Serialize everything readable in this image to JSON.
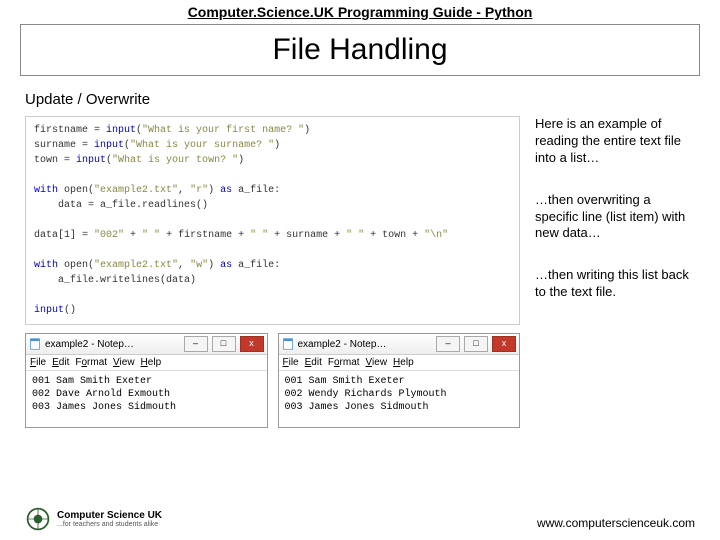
{
  "header": "Computer.Science.UK Programming Guide - Python",
  "title": "File Handling",
  "section": "Update / Overwrite",
  "code": {
    "l1a": "firstname = ",
    "l1b": "input",
    "l1c": "(",
    "l1d": "\"What is your first name? \"",
    "l1e": ")",
    "l2a": "surname = ",
    "l2b": "input",
    "l2c": "(",
    "l2d": "\"What is your surname? \"",
    "l2e": ")",
    "l3a": "town = ",
    "l3b": "input",
    "l3c": "(",
    "l3d": "\"What is your town? \"",
    "l3e": ")",
    "l4a": "with",
    "l4b": " open(",
    "l4c": "\"example2.txt\"",
    "l4d": ", ",
    "l4e": "\"r\"",
    "l4f": ") ",
    "l4g": "as",
    "l4h": " a_file:",
    "l5": "    data = a_file.readlines()",
    "l6a": "data[1] = ",
    "l6b": "\"002\"",
    "l6c": " + ",
    "l6d": "\" \"",
    "l6e": " + firstname + ",
    "l6f": "\" \"",
    "l6g": " + surname + ",
    "l6h": "\" \"",
    "l6i": " + town + ",
    "l6j": "\"\\n\"",
    "l7a": "with",
    "l7b": " open(",
    "l7c": "\"example2.txt\"",
    "l7d": ", ",
    "l7e": "\"w\"",
    "l7f": ") ",
    "l7g": "as",
    "l7h": " a_file:",
    "l8": "    a_file.writelines(data)",
    "l9a": "input",
    "l9b": "()"
  },
  "notepad": {
    "title": "example2 - Notep…",
    "min": "–",
    "max": "□",
    "close": "x",
    "menu": {
      "file": "File",
      "edit": "Edit",
      "format": "Format",
      "view": "View",
      "help": "Help"
    },
    "left_body": "001 Sam Smith Exeter\n002 Dave Arnold Exmouth\n003 James Jones Sidmouth",
    "right_body": "001 Sam Smith Exeter\n002 Wendy Richards Plymouth\n003 James Jones Sidmouth"
  },
  "explain": {
    "p1": "Here is an example of reading the entire text file into a list…",
    "p2": "…then overwriting a specific line (list item) with new data…",
    "p3": "…then writing this list back to the text file."
  },
  "footer_url": "www.computerscienceuk.com",
  "logo": {
    "line1": "Computer Science UK",
    "line2": "...for teachers and students alike"
  }
}
